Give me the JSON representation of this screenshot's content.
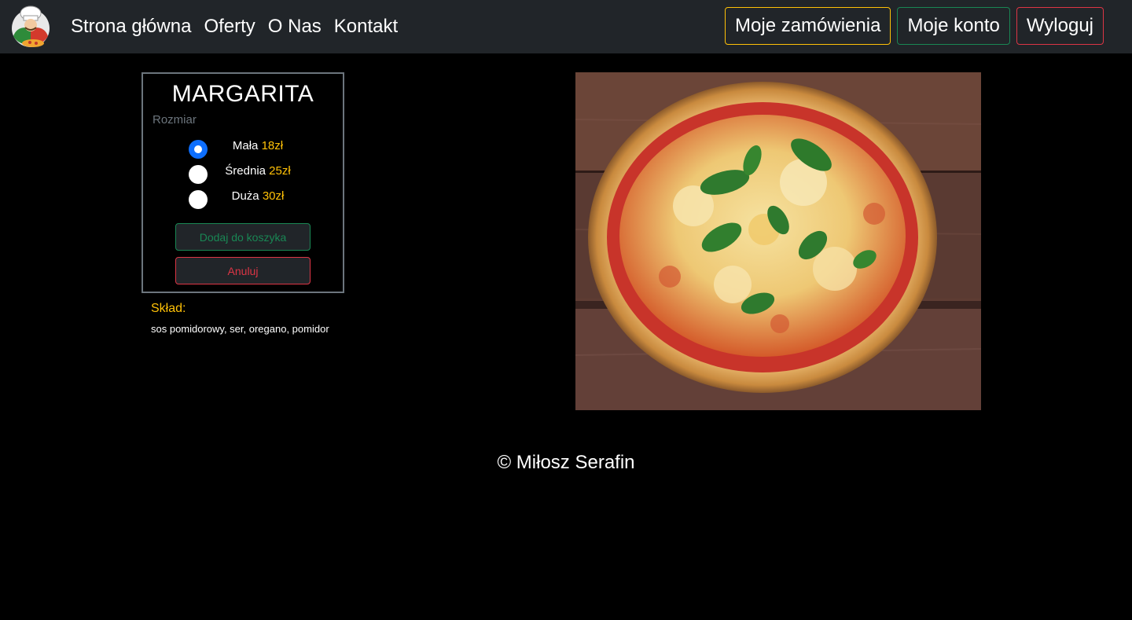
{
  "nav": {
    "links": [
      "Strona główna",
      "Oferty",
      "O Nas",
      "Kontakt"
    ],
    "buttons": {
      "orders": "Moje zamówienia",
      "account": "Moje konto",
      "logout": "Wyloguj"
    }
  },
  "product": {
    "name": "MARGARITA",
    "size_label": "Rozmiar",
    "sizes": [
      {
        "label": "Mała",
        "price": "18zł",
        "selected": true
      },
      {
        "label": "Średnia",
        "price": "25zł",
        "selected": false
      },
      {
        "label": "Duża",
        "price": "30zł",
        "selected": false
      }
    ],
    "add_to_cart": "Dodaj do koszyka",
    "cancel": "Anuluj",
    "ingredients_title": "Skład:",
    "ingredients": "sos pomidorowy, ser, oregano, pomidor"
  },
  "footer": {
    "text": "© Miłosz Serafin"
  },
  "colors": {
    "navbar": "#212529",
    "accent_yellow": "#ffc107",
    "success": "#198754",
    "danger": "#dc3545",
    "radio_selected": "#0d6efd"
  }
}
